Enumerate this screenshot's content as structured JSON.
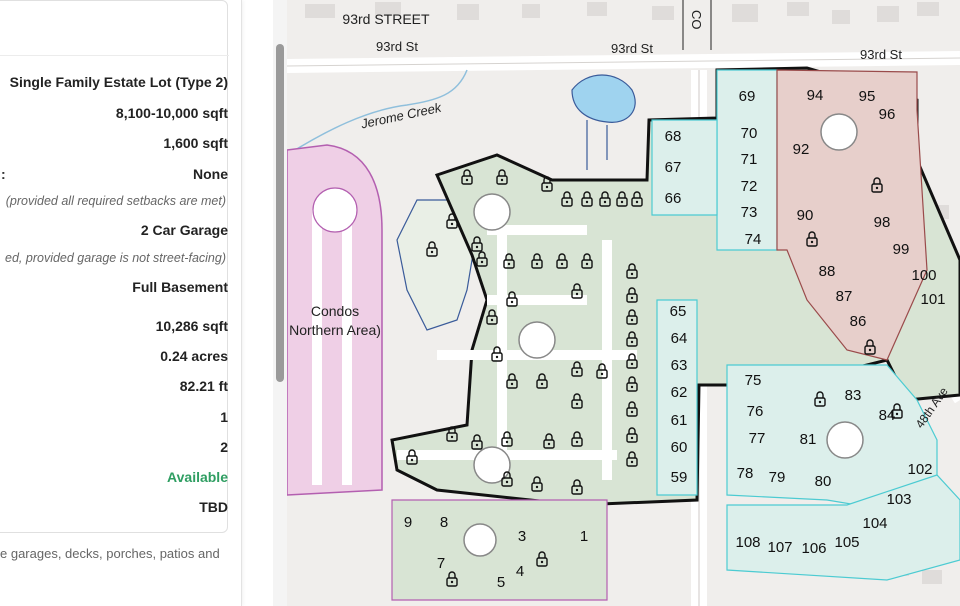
{
  "details": {
    "lot_type": "Single Family Estate Lot (Type 2)",
    "home_size": "8,100-10,000 sqft",
    "min_home": "1,600 sqft",
    "label_suffix": ":",
    "hoa": "None",
    "hoa_note": "(provided all required setbacks are met)",
    "garage": "2 Car Garage",
    "garage_note": "ed, provided garage is not street-facing)",
    "basement": "Full Basement",
    "lot_size": "10,286 sqft",
    "acres": "0.24 acres",
    "frontage": "82.21 ft",
    "stories": "1",
    "phase": "2",
    "status": "Available",
    "price": "TBD",
    "footnote": "e garages, decks, porches, patios and"
  },
  "map": {
    "streets": {
      "north_label": "93rd STREET",
      "north_road": "93rd St",
      "east_avenue": "48th Ave",
      "creek": "Jerome Creek",
      "cross_label": "CO",
      "condos_line1": "Condos",
      "condos_line2": "Northern Area)"
    },
    "colors": {
      "green_lot": "#d8e4d4",
      "teal_lot": "#dcefeb",
      "teal_stroke": "#4ccbd2",
      "red_lot": "#e7cfcb",
      "red_stroke": "#9a4b4b",
      "pink_area": "#efcfe6",
      "pink_stroke": "#b35fb0",
      "boundary": "#111111",
      "water": "#9fd3ef"
    },
    "lots": [
      {
        "number": "1",
        "zone": "green"
      },
      {
        "number": "3",
        "zone": "green"
      },
      {
        "number": "4",
        "zone": "green"
      },
      {
        "number": "5",
        "zone": "green"
      },
      {
        "number": "7",
        "zone": "green"
      },
      {
        "number": "8",
        "zone": "green"
      },
      {
        "number": "9",
        "zone": "green"
      },
      {
        "number": "59",
        "zone": "teal"
      },
      {
        "number": "60",
        "zone": "teal"
      },
      {
        "number": "61",
        "zone": "teal"
      },
      {
        "number": "62",
        "zone": "teal"
      },
      {
        "number": "63",
        "zone": "teal"
      },
      {
        "number": "64",
        "zone": "teal"
      },
      {
        "number": "65",
        "zone": "teal"
      },
      {
        "number": "66",
        "zone": "teal"
      },
      {
        "number": "67",
        "zone": "teal"
      },
      {
        "number": "68",
        "zone": "teal"
      },
      {
        "number": "69",
        "zone": "teal"
      },
      {
        "number": "70",
        "zone": "teal"
      },
      {
        "number": "71",
        "zone": "teal"
      },
      {
        "number": "72",
        "zone": "teal"
      },
      {
        "number": "73",
        "zone": "teal"
      },
      {
        "number": "74",
        "zone": "teal"
      },
      {
        "number": "75",
        "zone": "teal"
      },
      {
        "number": "76",
        "zone": "teal"
      },
      {
        "number": "77",
        "zone": "teal"
      },
      {
        "number": "78",
        "zone": "teal"
      },
      {
        "number": "79",
        "zone": "teal"
      },
      {
        "number": "80",
        "zone": "teal"
      },
      {
        "number": "81",
        "zone": "teal"
      },
      {
        "number": "83",
        "zone": "teal"
      },
      {
        "number": "84",
        "zone": "teal"
      },
      {
        "number": "86",
        "zone": "red"
      },
      {
        "number": "87",
        "zone": "red"
      },
      {
        "number": "88",
        "zone": "red"
      },
      {
        "number": "90",
        "zone": "red"
      },
      {
        "number": "92",
        "zone": "red"
      },
      {
        "number": "94",
        "zone": "red"
      },
      {
        "number": "95",
        "zone": "red"
      },
      {
        "number": "96",
        "zone": "red"
      },
      {
        "number": "98",
        "zone": "red"
      },
      {
        "number": "99",
        "zone": "red"
      },
      {
        "number": "100",
        "zone": "red"
      },
      {
        "number": "101",
        "zone": "red"
      },
      {
        "number": "102",
        "zone": "teal"
      },
      {
        "number": "103",
        "zone": "teal"
      },
      {
        "number": "104",
        "zone": "teal"
      },
      {
        "number": "105",
        "zone": "teal"
      },
      {
        "number": "106",
        "zone": "teal"
      },
      {
        "number": "107",
        "zone": "teal"
      },
      {
        "number": "108",
        "zone": "teal"
      }
    ]
  }
}
